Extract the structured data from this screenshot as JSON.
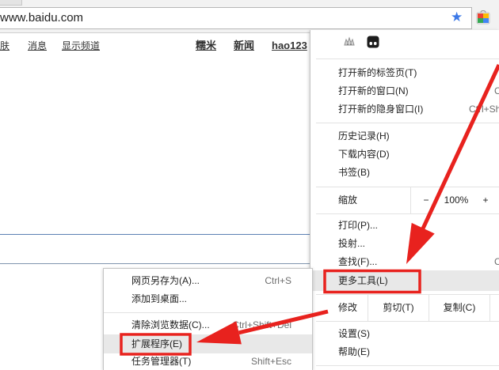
{
  "colors": {
    "accent_blue": "#3b78e7",
    "annotation_red": "#e8221e",
    "menu_highlight": "#e8e8e8"
  },
  "toolbar": {
    "url": "www.baidu.com",
    "star_icon": "bookmark-star-icon",
    "extension_icon": "webstore-icon"
  },
  "baidu_nav": {
    "left_links": [
      "肤",
      "消息",
      "显示频道"
    ],
    "right_links": [
      "糯米",
      "新闻",
      "hao123"
    ]
  },
  "chrome_menu": {
    "extension_icons": [
      "grey-extension-icon",
      "black-extension-icon"
    ],
    "window_items": [
      {
        "label": "打开新的标签页(T)"
      },
      {
        "label": "打开新的窗口(N)",
        "shortcut": "C"
      },
      {
        "label": "打开新的隐身窗口(I)",
        "shortcut": "Ctrl+Sh"
      }
    ],
    "history_items": [
      {
        "label": "历史记录(H)"
      },
      {
        "label": "下载内容(D)"
      },
      {
        "label": "书签(B)"
      }
    ],
    "zoom": {
      "label": "缩放",
      "minus": "−",
      "value": "100%",
      "plus": "+"
    },
    "page_items": [
      {
        "label": "打印(P)..."
      },
      {
        "label": "投射..."
      },
      {
        "label": "查找(F)...",
        "shortcut": "C"
      }
    ],
    "more_tools": {
      "label": "更多工具(L)"
    },
    "edit": {
      "label": "修改",
      "cut": "剪切(T)",
      "copy": "复制(C)"
    },
    "settings_items": [
      {
        "label": "设置(S)"
      },
      {
        "label": "帮助(E)"
      }
    ]
  },
  "more_tools_submenu": {
    "items": [
      {
        "label": "网页另存为(A)...",
        "shortcut": "Ctrl+S"
      },
      {
        "label": "添加到桌面..."
      },
      {
        "label": "清除浏览数据(C)...",
        "shortcut": "Ctrl+Shift+Del"
      },
      {
        "label": "扩展程序(E)"
      },
      {
        "label": "任务管理器(T)",
        "shortcut": "Shift+Esc"
      }
    ]
  }
}
